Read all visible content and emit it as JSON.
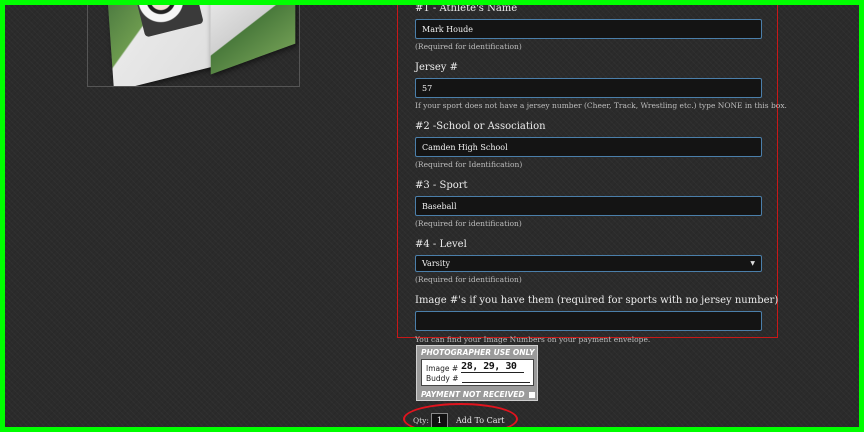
{
  "form": {
    "fields": [
      {
        "label": "#1 - Athlete's Name",
        "value": "Mark Houde",
        "hint": "(Required for identification)"
      },
      {
        "label": "Jersey #",
        "value": "57",
        "hint": "If your sport does not have a jersey number (Cheer, Track, Wrestling etc.) type NONE in this box."
      },
      {
        "label": "#2 -School or Association",
        "value": "Camden High School",
        "hint": "(Required for Identification)"
      },
      {
        "label": "#3 - Sport",
        "value": "Baseball",
        "hint": "(Required for identification)"
      },
      {
        "label": "#4 - Level",
        "value": "Varsity",
        "hint": "(Required for identification)"
      },
      {
        "label": "Image #'s if you have them (required for sports with no jersey number)",
        "value": "",
        "hint": "You can find your Image Numbers on your payment envelope."
      }
    ]
  },
  "photographer_box": {
    "header": "PHOTOGRAPHER USE ONLY",
    "image_label": "Image #",
    "image_value": "28, 29, 30",
    "buddy_label": "Buddy #",
    "footer": "PAYMENT NOT RECEIVED"
  },
  "cart": {
    "qty_label": "Qty:",
    "qty_value": "1",
    "add_label": "Add To Cart"
  },
  "colors": {
    "background": "#2b2b2b",
    "frame": "#00ff00",
    "highlight_red": "#e0141e",
    "input_border": "#4b7faa"
  },
  "icons": {
    "select_arrow": "chevron-down-icon"
  }
}
